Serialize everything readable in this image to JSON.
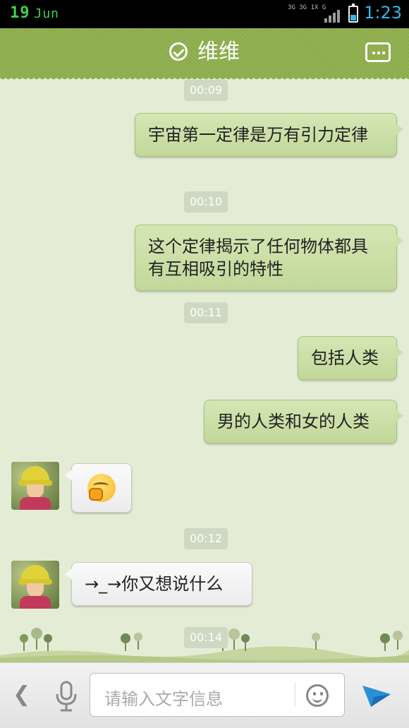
{
  "status": {
    "date_day": "19",
    "date_month": "Jun",
    "network_top": "3G 3G 1X G",
    "time": "1:23"
  },
  "header": {
    "title": "维维",
    "verified_icon": "check-circle-icon",
    "more_icon": "more-dots-icon"
  },
  "chat": {
    "timestamps": [
      "00:09",
      "00:10",
      "00:11",
      "00:12",
      "00:14"
    ],
    "messages": [
      {
        "side": "out",
        "text": "宇宙第一定律是万有引力定律"
      },
      {
        "side": "out",
        "text": "这个定律揭示了任何物体都具有互相吸引的特性"
      },
      {
        "side": "out",
        "text": "包括人类"
      },
      {
        "side": "out",
        "text": "男的人类和女的人类"
      },
      {
        "side": "in",
        "type": "emoji",
        "emoji_icon": "shy-smile-emoji-icon"
      },
      {
        "side": "in",
        "text": "→_→你又想说什么"
      }
    ]
  },
  "input": {
    "placeholder": "请输入文字信息",
    "back_icon": "chevron-left-icon",
    "mic_icon": "microphone-icon",
    "emoji_icon": "smiley-icon",
    "send_icon": "send-icon"
  },
  "colors": {
    "title_bar": "#8fae50",
    "outgoing_bubble": "#c9dda3",
    "incoming_bubble": "#f4f4f4",
    "background": "#e4ecd6",
    "status_time": "#33b5e5",
    "send": "#2b8fd8"
  }
}
